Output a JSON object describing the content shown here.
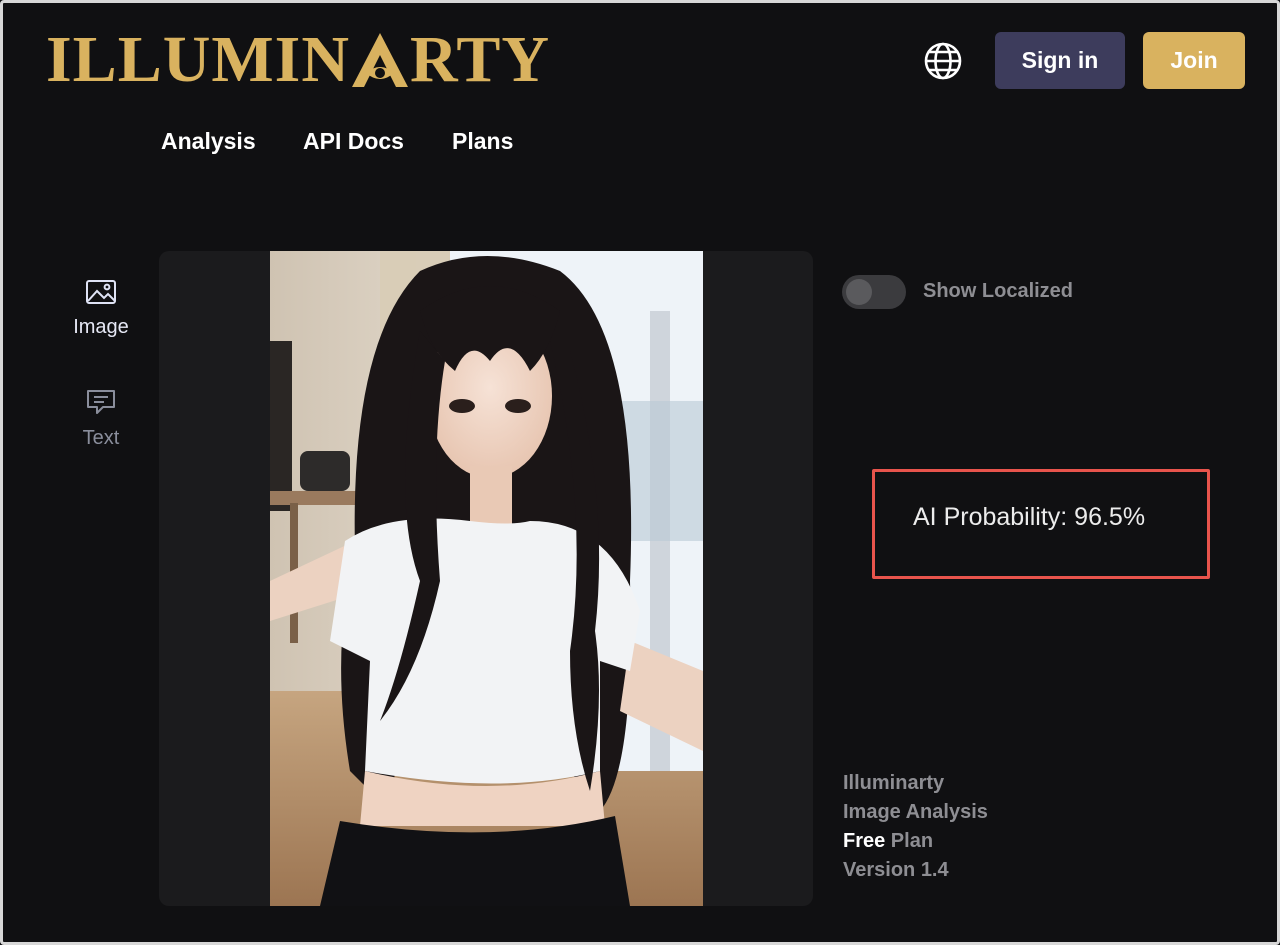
{
  "header": {
    "logo_text_left": "ILLUMIN",
    "logo_text_right": "RTY",
    "logo_color": "#d9b25f",
    "signin_label": "Sign in",
    "join_label": "Join",
    "signin_color": "#3d3c5c",
    "join_color": "#d9b25f"
  },
  "nav": {
    "items": [
      {
        "label": "Analysis"
      },
      {
        "label": "API Docs"
      },
      {
        "label": "Plans"
      }
    ]
  },
  "sidebar": {
    "items": [
      {
        "label": "Image",
        "icon": "image-icon",
        "active": true
      },
      {
        "label": "Text",
        "icon": "message-icon",
        "active": false
      }
    ]
  },
  "main": {
    "toggle_label": "Show Localized",
    "toggle_on": false,
    "probability_text": "AI Probability: 96.5%",
    "highlight_color": "#e8544c"
  },
  "info": {
    "line1": "Illuminarty",
    "line2": "Image Analysis",
    "plan_tier": "Free",
    "plan_suffix": " Plan",
    "version": "Version 1.4"
  }
}
